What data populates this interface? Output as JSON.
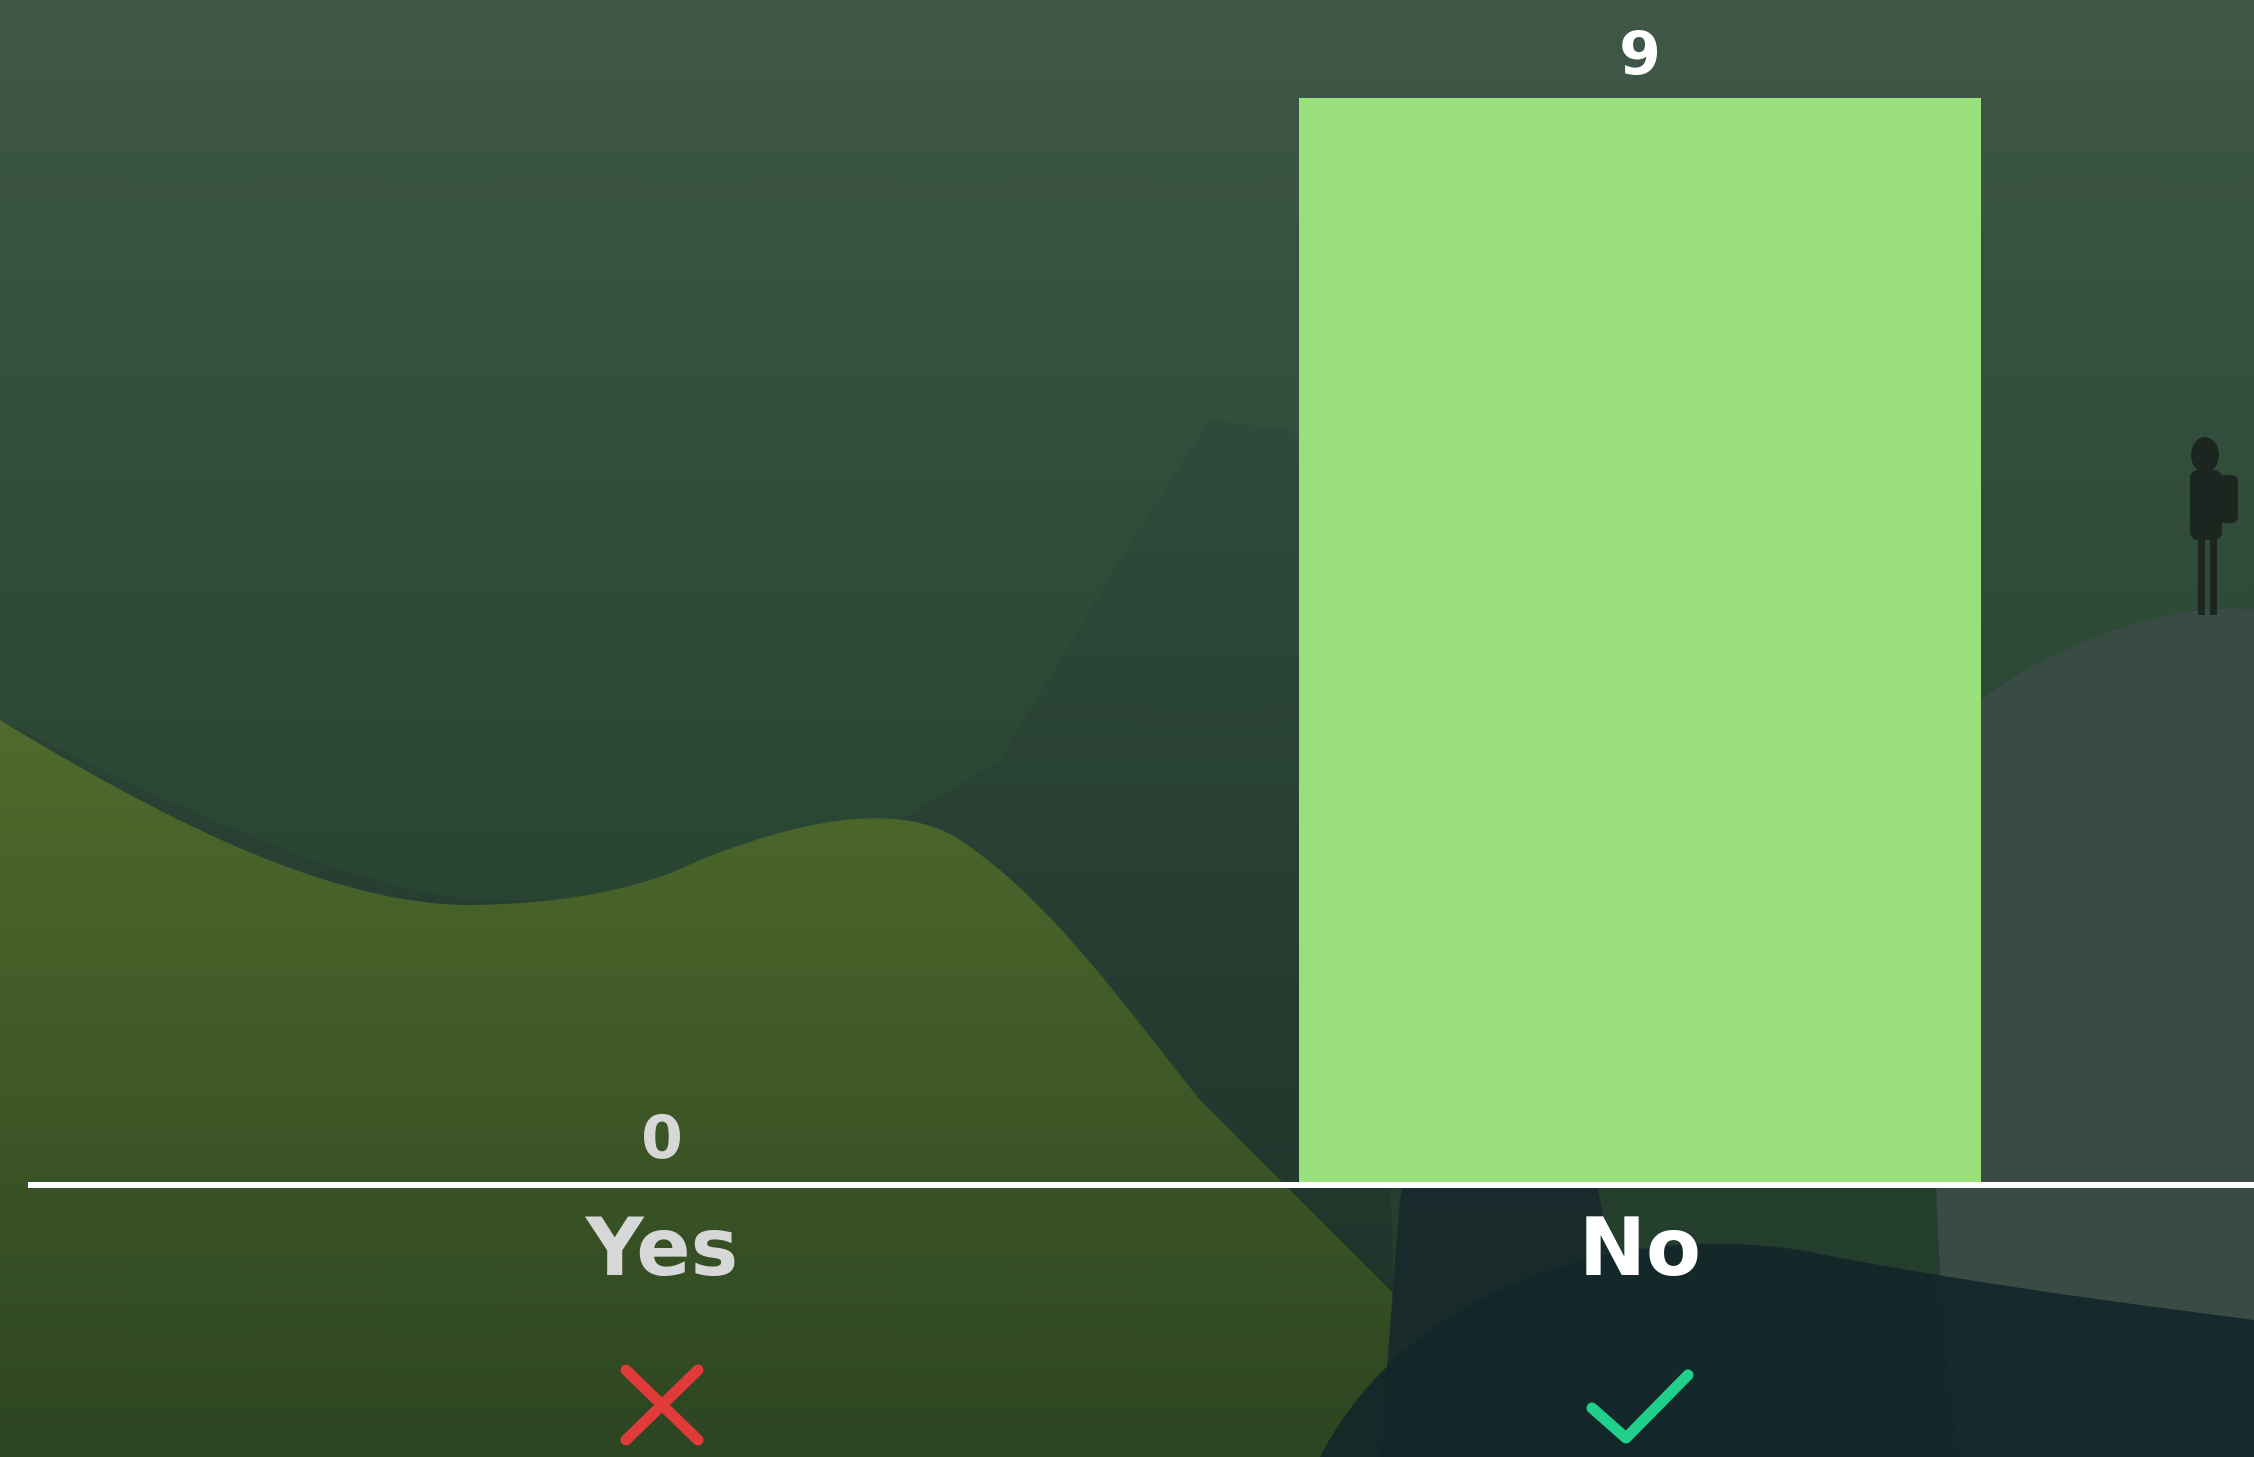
{
  "chart_data": {
    "type": "bar",
    "categories": [
      "Yes",
      "No"
    ],
    "values": [
      0,
      9
    ],
    "ylim": [
      0,
      9
    ],
    "grid": false,
    "bar_color": "#99e07c",
    "markers": [
      {
        "category": "Yes",
        "icon": "cross-icon",
        "color": "#e03a3a",
        "correct": false
      },
      {
        "category": "No",
        "icon": "check-icon",
        "color": "#1fcf8a",
        "correct": true
      }
    ]
  },
  "colors": {
    "label_default": "#d7d7d7",
    "label_correct": "#ffffff",
    "baseline": "#ffffff"
  }
}
